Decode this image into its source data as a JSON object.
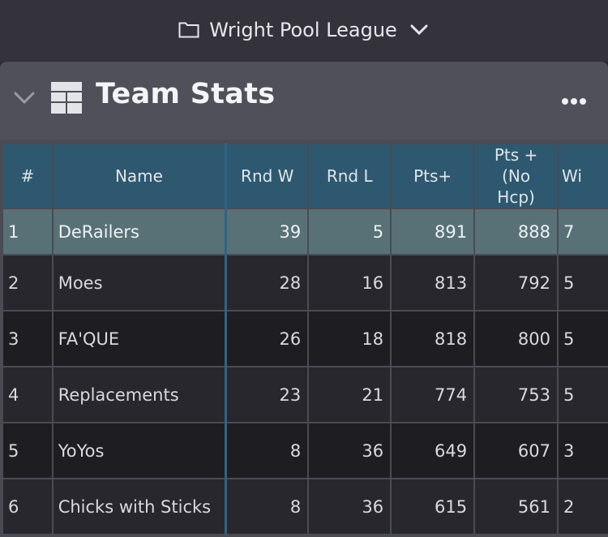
{
  "top_bar": {
    "folder_icon": "folder-icon",
    "league_name": "Wright Pool League",
    "dropdown_icon": "chevron-down-icon"
  },
  "panel": {
    "collapse_icon": "chevron-down-icon",
    "table_icon": "table-icon",
    "title": "Team Stats",
    "more_icon": "more-horizontal-icon"
  },
  "table": {
    "columns": [
      "#",
      "Name",
      "Rnd W",
      "Rnd L",
      "Pts+",
      "Pts + (No Hcp)",
      "Wi"
    ],
    "rows": [
      {
        "rank": "1",
        "name": "DeRailers",
        "rnd_w": "39",
        "rnd_l": "5",
        "pts_plus": "891",
        "pts_no_hcp": "888",
        "partial": "7",
        "selected": true
      },
      {
        "rank": "2",
        "name": "Moes",
        "rnd_w": "28",
        "rnd_l": "16",
        "pts_plus": "813",
        "pts_no_hcp": "792",
        "partial": "5"
      },
      {
        "rank": "3",
        "name": "FA'QUE",
        "rnd_w": "26",
        "rnd_l": "18",
        "pts_plus": "818",
        "pts_no_hcp": "800",
        "partial": "5"
      },
      {
        "rank": "4",
        "name": "Replacements",
        "rnd_w": "23",
        "rnd_l": "21",
        "pts_plus": "774",
        "pts_no_hcp": "753",
        "partial": "5"
      },
      {
        "rank": "5",
        "name": "YoYos",
        "rnd_w": "8",
        "rnd_l": "36",
        "pts_plus": "649",
        "pts_no_hcp": "607",
        "partial": "3"
      },
      {
        "rank": "6",
        "name": "Chicks with Sticks",
        "rnd_w": "8",
        "rnd_l": "36",
        "pts_plus": "615",
        "pts_no_hcp": "561",
        "partial": "2"
      }
    ]
  },
  "colors": {
    "header_bg": "#2e5870",
    "selected_row_bg": "#587177",
    "panel_bg": "#4f5059",
    "top_bar_bg": "#34333c"
  }
}
